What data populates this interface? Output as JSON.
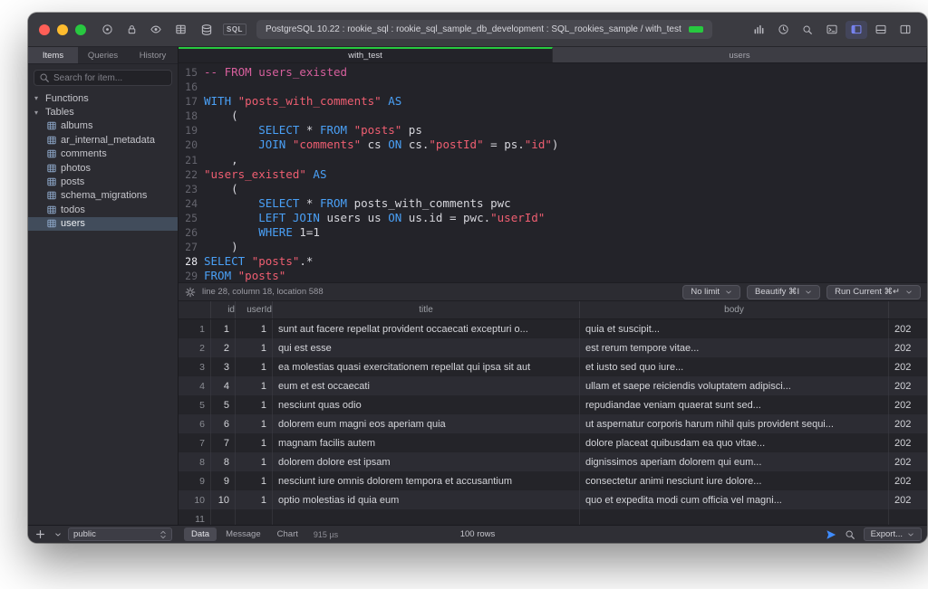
{
  "titlebar": {
    "title": "PostgreSQL 10.22 : rookie_sql : rookie_sql_sample_db_development : SQL_rookies_sample / with_test",
    "sql_badge": "SQL",
    "connection_color": "#27c93f",
    "left_icons": [
      "target-icon",
      "lock-icon",
      "eye-icon",
      "grid-icon"
    ],
    "right_icons": [
      {
        "name": "chart-icon",
        "active": false
      },
      {
        "name": "clock-icon",
        "active": false
      },
      {
        "name": "search-icon",
        "active": false
      },
      {
        "name": "terminal-icon",
        "active": false
      },
      {
        "name": "panel-left-icon",
        "active": true
      },
      {
        "name": "panel-bottom-icon",
        "active": false
      },
      {
        "name": "panel-right-icon",
        "active": false
      }
    ]
  },
  "sidebar": {
    "tabs": [
      {
        "label": "Items",
        "active": true
      },
      {
        "label": "Queries",
        "active": false
      },
      {
        "label": "History",
        "active": false
      }
    ],
    "search_placeholder": "Search for item...",
    "tree": [
      {
        "label": "Functions",
        "type": "group"
      },
      {
        "label": "Tables",
        "type": "group"
      },
      {
        "label": "albums",
        "type": "table"
      },
      {
        "label": "ar_internal_metadata",
        "type": "table"
      },
      {
        "label": "comments",
        "type": "table"
      },
      {
        "label": "photos",
        "type": "table"
      },
      {
        "label": "posts",
        "type": "table"
      },
      {
        "label": "schema_migrations",
        "type": "table"
      },
      {
        "label": "todos",
        "type": "table"
      },
      {
        "label": "users",
        "type": "table",
        "selected": true
      }
    ]
  },
  "editor_tabs": [
    {
      "label": "with_test",
      "active": true
    },
    {
      "label": "users",
      "active": false
    }
  ],
  "editor": {
    "lines": [
      {
        "num": 15,
        "segments": [
          [
            "c",
            "-- FROM users_existed"
          ]
        ]
      },
      {
        "num": 16,
        "segments": []
      },
      {
        "num": 17,
        "segments": [
          [
            "k",
            "WITH "
          ],
          [
            "s",
            "\"posts_with_comments\""
          ],
          [
            "p",
            " "
          ],
          [
            "k",
            "AS"
          ]
        ]
      },
      {
        "num": 18,
        "segments": [
          [
            "p",
            "    ("
          ]
        ]
      },
      {
        "num": 19,
        "segments": [
          [
            "p",
            "        "
          ],
          [
            "k",
            "SELECT"
          ],
          [
            "p",
            " * "
          ],
          [
            "k",
            "FROM"
          ],
          [
            "p",
            " "
          ],
          [
            "s",
            "\"posts\""
          ],
          [
            "p",
            " ps"
          ]
        ]
      },
      {
        "num": 20,
        "segments": [
          [
            "p",
            "        "
          ],
          [
            "k",
            "JOIN"
          ],
          [
            "p",
            " "
          ],
          [
            "s",
            "\"comments\""
          ],
          [
            "p",
            " cs "
          ],
          [
            "k",
            "ON"
          ],
          [
            "p",
            " cs."
          ],
          [
            "s",
            "\"postId\""
          ],
          [
            "p",
            " = ps."
          ],
          [
            "s",
            "\"id\""
          ],
          [
            "p",
            ")"
          ]
        ]
      },
      {
        "num": 21,
        "segments": [
          [
            "p",
            "    ,"
          ]
        ]
      },
      {
        "num": 22,
        "segments": [
          [
            "s",
            "\"users_existed\""
          ],
          [
            "p",
            " "
          ],
          [
            "k",
            "AS"
          ]
        ]
      },
      {
        "num": 23,
        "segments": [
          [
            "p",
            "    ("
          ]
        ]
      },
      {
        "num": 24,
        "segments": [
          [
            "p",
            "        "
          ],
          [
            "k",
            "SELECT"
          ],
          [
            "p",
            " * "
          ],
          [
            "k",
            "FROM"
          ],
          [
            "p",
            " posts_with_comments pwc"
          ]
        ]
      },
      {
        "num": 25,
        "segments": [
          [
            "p",
            "        "
          ],
          [
            "k",
            "LEFT JOIN"
          ],
          [
            "p",
            " users us "
          ],
          [
            "k",
            "ON"
          ],
          [
            "p",
            " us.id = pwc."
          ],
          [
            "s",
            "\"userId\""
          ]
        ]
      },
      {
        "num": 26,
        "segments": [
          [
            "p",
            "        "
          ],
          [
            "k",
            "WHERE"
          ],
          [
            "p",
            " 1=1"
          ]
        ]
      },
      {
        "num": 27,
        "segments": [
          [
            "p",
            "    )"
          ]
        ]
      },
      {
        "num": 28,
        "current": true,
        "segments": [
          [
            "k",
            "SELECT "
          ],
          [
            "s",
            "\"posts\""
          ],
          [
            "p",
            ".*"
          ]
        ]
      },
      {
        "num": 29,
        "segments": [
          [
            "k",
            "FROM "
          ],
          [
            "s",
            "\"posts\""
          ]
        ]
      }
    ]
  },
  "statusbar": {
    "position": "line 28, column 18, location 588",
    "buttons": [
      "No limit",
      "Beautify ⌘I",
      "Run Current ⌘↵"
    ]
  },
  "results": {
    "columns": [
      "id",
      "userId",
      "title",
      "body",
      ""
    ],
    "rows": [
      {
        "num": 1,
        "id": 1,
        "userId": 1,
        "title": "sunt aut facere repellat provident occaecati excepturi o...",
        "body": "quia et suscipit...",
        "extra": "202"
      },
      {
        "num": 2,
        "id": 2,
        "userId": 1,
        "title": "qui est esse",
        "body": "est rerum tempore vitae...",
        "extra": "202"
      },
      {
        "num": 3,
        "id": 3,
        "userId": 1,
        "title": "ea molestias quasi exercitationem repellat qui ipsa sit aut",
        "body": "et iusto sed quo iure...",
        "extra": "202"
      },
      {
        "num": 4,
        "id": 4,
        "userId": 1,
        "title": "eum et est occaecati",
        "body": "ullam et saepe reiciendis voluptatem adipisci...",
        "extra": "202"
      },
      {
        "num": 5,
        "id": 5,
        "userId": 1,
        "title": "nesciunt quas odio",
        "body": "repudiandae veniam quaerat sunt sed...",
        "extra": "202"
      },
      {
        "num": 6,
        "id": 6,
        "userId": 1,
        "title": "dolorem eum magni eos aperiam quia",
        "body": "ut aspernatur corporis harum nihil quis provident sequi...",
        "extra": "202"
      },
      {
        "num": 7,
        "id": 7,
        "userId": 1,
        "title": "magnam facilis autem",
        "body": "dolore placeat quibusdam ea quo vitae...",
        "extra": "202"
      },
      {
        "num": 8,
        "id": 8,
        "userId": 1,
        "title": "dolorem dolore est ipsam",
        "body": "dignissimos aperiam dolorem qui eum...",
        "extra": "202"
      },
      {
        "num": 9,
        "id": 9,
        "userId": 1,
        "title": "nesciunt iure omnis dolorem tempora et accusantium",
        "body": "consectetur animi nesciunt iure dolore...",
        "extra": "202"
      },
      {
        "num": 10,
        "id": 10,
        "userId": 1,
        "title": "optio molestias id quia eum",
        "body": "quo et expedita modi cum officia vel magni...",
        "extra": "202"
      },
      {
        "num": 11,
        "id": "",
        "userId": "",
        "title": "",
        "body": "",
        "extra": ""
      }
    ]
  },
  "bottombar": {
    "schema": "public",
    "tabs": [
      {
        "label": "Data",
        "active": true
      },
      {
        "label": "Message",
        "active": false
      },
      {
        "label": "Chart",
        "active": false
      }
    ],
    "time": "915 µs",
    "row_count": "100 rows",
    "export_label": "Export..."
  }
}
